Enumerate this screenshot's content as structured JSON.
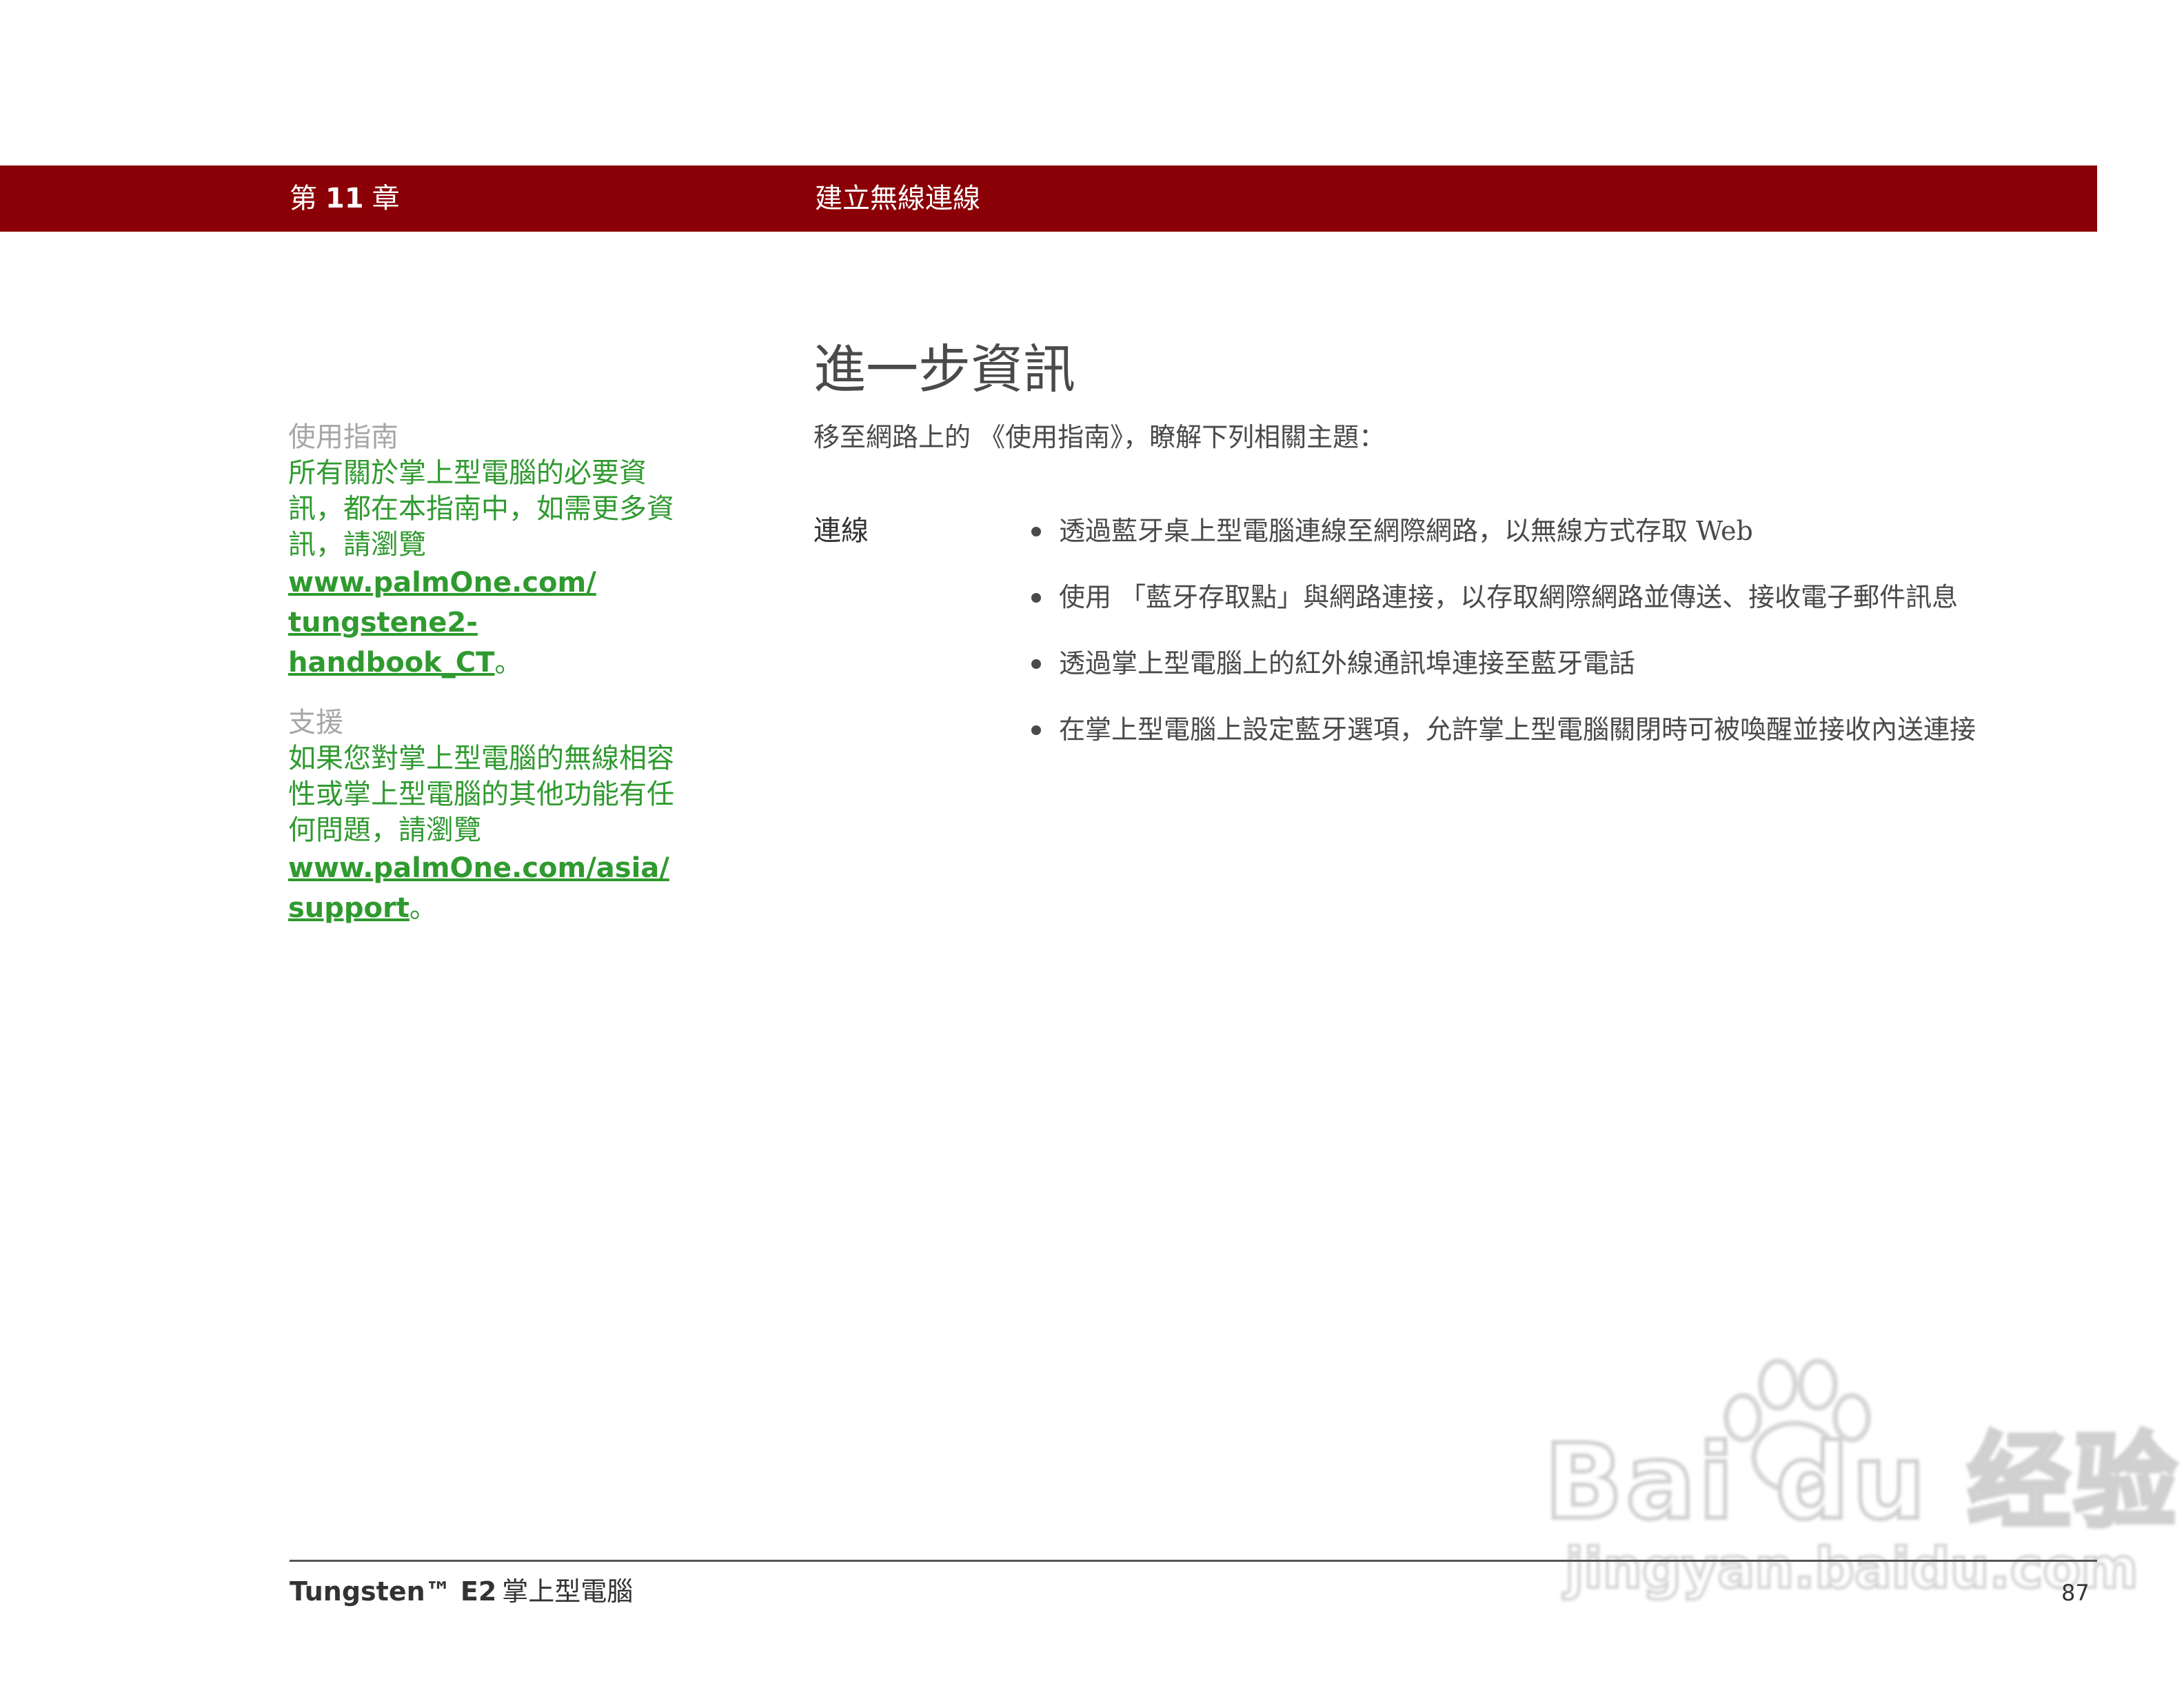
{
  "header": {
    "chapter_prefix": "第",
    "chapter_number": "11",
    "chapter_suffix": "章",
    "section_title": "建立無線連線"
  },
  "page": {
    "heading": "進一步資訊",
    "intro": "移至網路上的 《使用指南》，瞭解下列相關主題："
  },
  "sidebar": [
    {
      "title": "使用指南",
      "body": "所有關於掌上型電腦的必要資訊，都在本指南中，如需更多資訊，請瀏覽",
      "link_line1": "www.palmOne.com/",
      "link_line2": "tungstene2-handbook_CT",
      "tail": "。"
    },
    {
      "title": "支援",
      "body": "如果您對掌上型電腦的無線相容性或掌上型電腦的其他功能有任何問題，請瀏覽",
      "link_line1": "www.palmOne.com/asia/",
      "link_line2": "support",
      "tail": "。"
    }
  ],
  "topic": {
    "label": "連線",
    "bullets": [
      "透過藍牙桌上型電腦連線至網際網路，以無線方式存取 Web",
      "使用 「藍牙存取點」與網路連接，以存取網際網路並傳送、接收電子郵件訊息",
      "透過掌上型電腦上的紅外線通訊埠連接至藍牙電話",
      "在掌上型電腦上設定藍牙選項，允許掌上型電腦關閉時可被喚醒並接收內送連接"
    ]
  },
  "footer": {
    "brand": "Tungsten™ E2",
    "product": "掌上型電腦",
    "page_number": "87"
  },
  "watermark": {
    "logo": "Bai du 经验",
    "url": "jingyan.baidu.com"
  },
  "colors": {
    "header_bar": "#8a0006",
    "sidebar_link": "#2f9a2f",
    "sidebar_title": "#a6a6a6",
    "body_text": "#4a4a4a"
  }
}
